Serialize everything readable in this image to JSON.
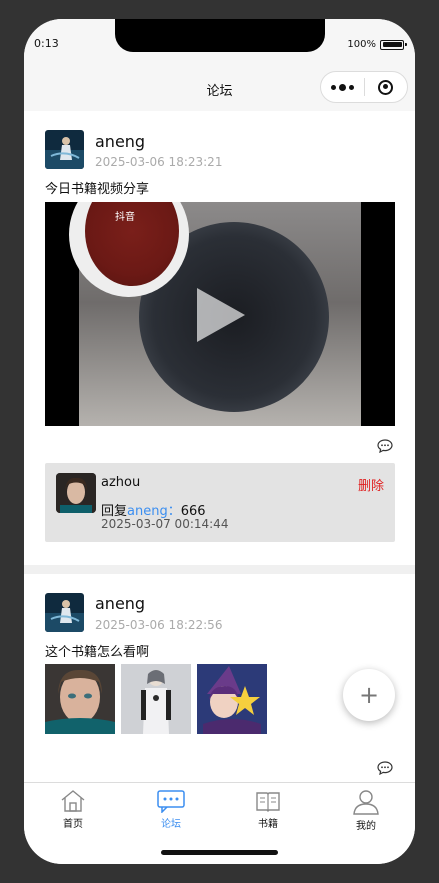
{
  "status_bar": {
    "time": "0:13",
    "battery": "100%"
  },
  "nav": {
    "title": "论坛"
  },
  "posts": [
    {
      "author": "aneng",
      "time": "2025-03-06 18:23:21",
      "text": "今日书籍视频分享",
      "video": {
        "watermark": "抖音"
      },
      "reply": {
        "author": "azhou",
        "delete_label": "删除",
        "prefix": "回复",
        "to": "aneng：",
        "content": "666",
        "time": "2025-03-07 00:14:44"
      }
    },
    {
      "author": "aneng",
      "time": "2025-03-06 18:22:56",
      "text": "这个书籍怎么看啊"
    }
  ],
  "fab": {
    "label": "+"
  },
  "tabbar": {
    "items": [
      {
        "label": "首页",
        "icon": "home-icon"
      },
      {
        "label": "论坛",
        "icon": "forum-icon",
        "active": true
      },
      {
        "label": "书籍",
        "icon": "book-icon"
      },
      {
        "label": "我的",
        "icon": "user-icon"
      }
    ]
  },
  "colors": {
    "accent": "#3b8ef0",
    "delete": "#e02020",
    "reply_bg": "#e3e3e3"
  }
}
